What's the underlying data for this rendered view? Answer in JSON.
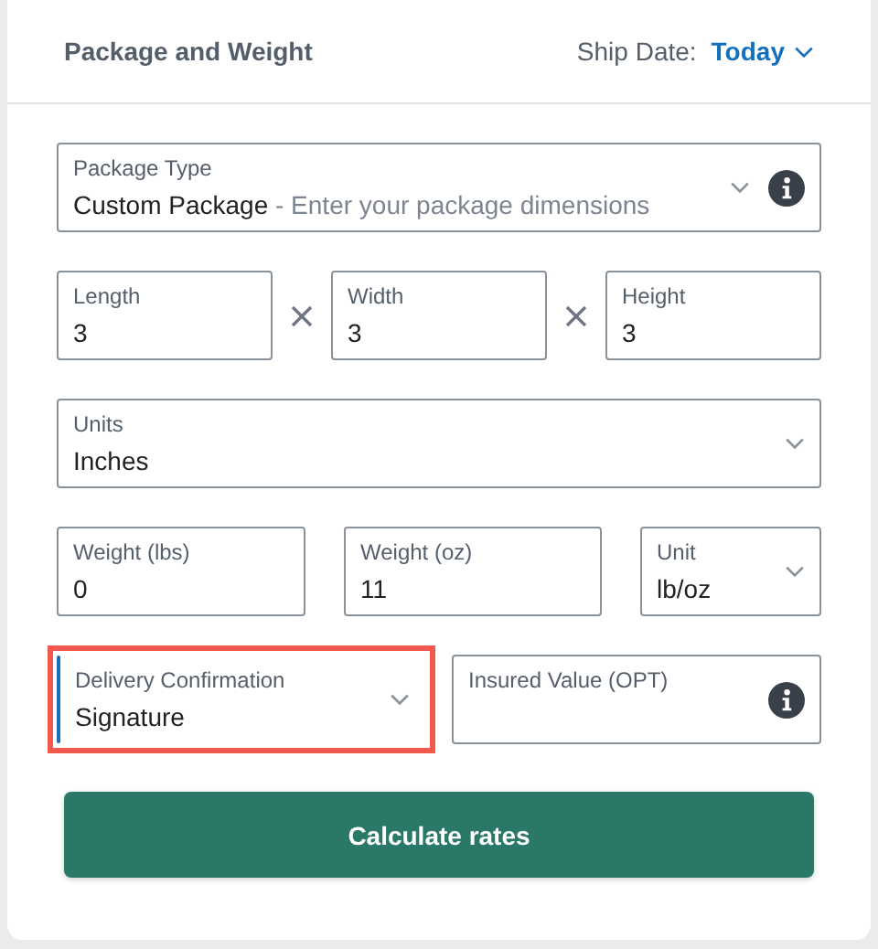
{
  "header": {
    "title": "Package and Weight",
    "ship_date_label": "Ship Date:",
    "ship_date_value": "Today"
  },
  "rows": [
    {
      "kind": "single",
      "fields": [
        {
          "kind": "select",
          "label": "Package Type",
          "value": "Custom Package",
          "hint": "- Enter your package dimensions",
          "info": true,
          "focused": false,
          "highlighted": false
        }
      ]
    },
    {
      "kind": "dimensions",
      "fields": [
        {
          "kind": "input",
          "label": "Length",
          "value": "3",
          "info": false,
          "focused": false,
          "highlighted": false
        },
        {
          "kind": "input",
          "label": "Width",
          "value": "3",
          "info": false,
          "focused": false,
          "highlighted": false
        },
        {
          "kind": "input",
          "label": "Height",
          "value": "3",
          "info": false,
          "focused": false,
          "highlighted": false
        }
      ]
    },
    {
      "kind": "single",
      "fields": [
        {
          "kind": "select",
          "label": "Units",
          "value": "Inches",
          "info": false,
          "focused": false,
          "highlighted": false
        }
      ]
    },
    {
      "kind": "weight",
      "fields": [
        {
          "kind": "input",
          "label": "Weight (lbs)",
          "value": "0",
          "info": false,
          "focused": false,
          "highlighted": false
        },
        {
          "kind": "input",
          "label": "Weight (oz)",
          "value": "11",
          "info": false,
          "focused": false,
          "highlighted": false
        },
        {
          "kind": "select",
          "label": "Unit",
          "value": "lb/oz",
          "info": false,
          "focused": false,
          "highlighted": false
        }
      ]
    },
    {
      "kind": "options",
      "fields": [
        {
          "kind": "select",
          "label": "Delivery Confirmation",
          "value": "Signature",
          "info": false,
          "focused": true,
          "highlighted": true
        },
        {
          "kind": "input",
          "label": "Insured Value (OPT)",
          "info": true,
          "focused": false,
          "highlighted": false
        }
      ]
    }
  ],
  "submit": {
    "label": "Calculate rates"
  }
}
